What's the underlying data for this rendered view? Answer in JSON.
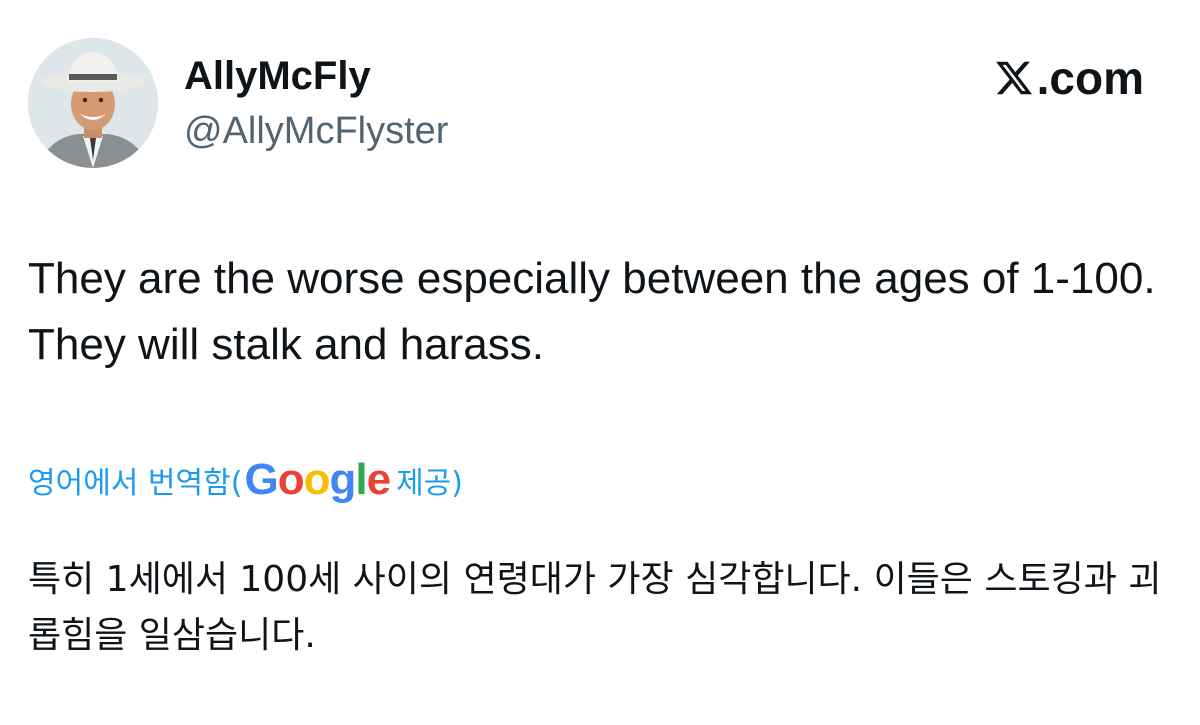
{
  "user": {
    "display_name": "AllyMcFly",
    "handle": "@AllyMcFlyster",
    "avatar": "cowboy-hat-man-avatar"
  },
  "brand": {
    "icon": "x-logo-icon",
    "text": ".com"
  },
  "tweet": {
    "text": "They are the worse especially between the ages of 1-100. They will stalk and harass."
  },
  "translation": {
    "prefix": "영어에서 번역함(",
    "provider": [
      "G",
      "o",
      "o",
      "g",
      "l",
      "e"
    ],
    "suffix": " 제공)",
    "text": "특히 1세에서 100세 사이의 연령대가 가장 심각합니다. 이들은 스토킹과 괴롭힘을 일삼습니다."
  },
  "colors": {
    "link": "#1d9bf0",
    "handle": "#536471",
    "text": "#0f1419",
    "google_blue": "#4285f4",
    "google_red": "#ea4335",
    "google_yellow": "#fbbc05",
    "google_green": "#34a853"
  }
}
